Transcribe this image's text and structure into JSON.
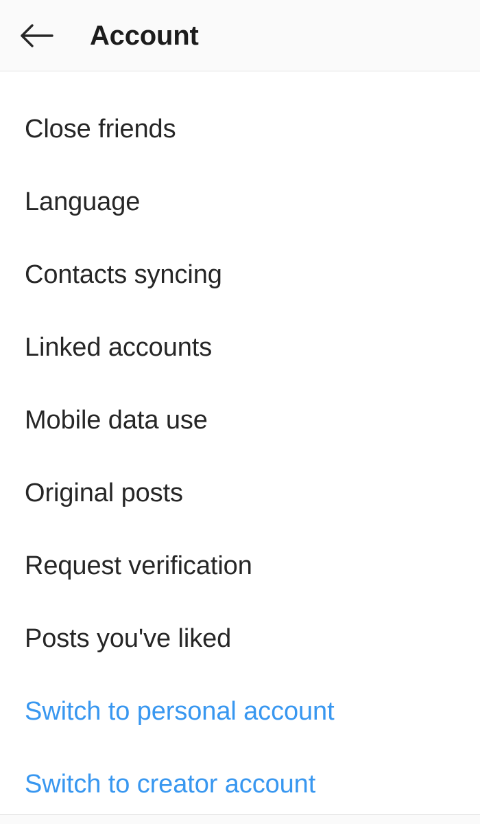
{
  "header": {
    "title": "Account",
    "back_icon": "arrow-left-icon",
    "background_color": "#fafafa"
  },
  "colors": {
    "text_primary": "#262626",
    "accent_link": "#3897f0",
    "divider": "#e4e4e4",
    "background": "#ffffff"
  },
  "list": {
    "items": [
      {
        "label": "Close friends",
        "style": "default"
      },
      {
        "label": "Language",
        "style": "default"
      },
      {
        "label": "Contacts syncing",
        "style": "default"
      },
      {
        "label": "Linked accounts",
        "style": "default"
      },
      {
        "label": "Mobile data use",
        "style": "default"
      },
      {
        "label": "Original posts",
        "style": "default"
      },
      {
        "label": "Request verification",
        "style": "default"
      },
      {
        "label": "Posts you've liked",
        "style": "default"
      },
      {
        "label": "Switch to personal account",
        "style": "accent"
      },
      {
        "label": "Switch to creator account",
        "style": "accent"
      }
    ]
  }
}
